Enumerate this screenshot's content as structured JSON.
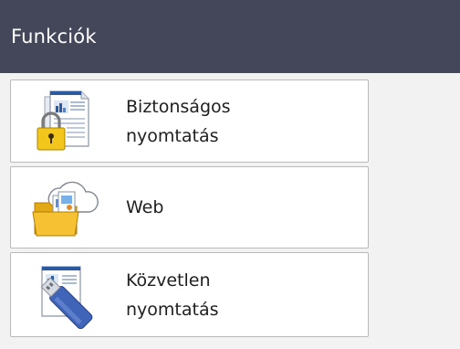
{
  "header": {
    "title": "Funkciók"
  },
  "menu": {
    "secure_print": {
      "line1": "Biztonságos",
      "line2": "nyomtatás",
      "icon": "secure-print-lock-icon"
    },
    "web": {
      "line1": "Web",
      "icon": "web-cloud-folder-icon"
    },
    "direct_print": {
      "line1": "Közvetlen",
      "line2": "nyomtatás",
      "icon": "usb-direct-print-icon"
    }
  },
  "colors": {
    "header_bg": "#44475a",
    "header_text": "#ffffff",
    "page_bg": "#f2f2f2",
    "button_bg": "#ffffff",
    "button_border": "#b9b9b9"
  }
}
